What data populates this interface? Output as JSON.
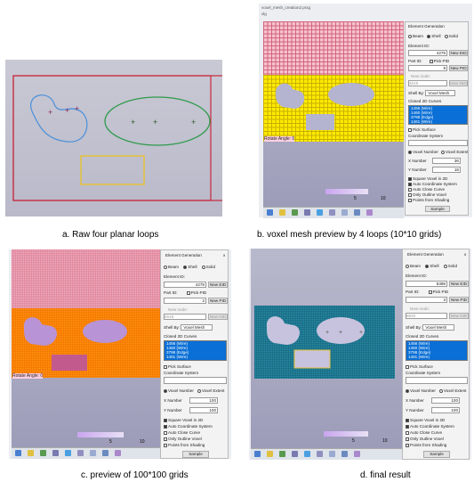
{
  "captions": {
    "a": "a. Raw four planar loops",
    "b": "b. voxel mesh preview by 4 loops (10*10 grids)",
    "c": "c. preview of 100*100 grids",
    "d": "d. final result"
  },
  "window_title": "voxel_mesh_creation2.prxg",
  "window_subtitle": "xlg",
  "rotate_label": "Rotate Angle: 0",
  "scale": {
    "min": "5",
    "max": "10"
  },
  "toolbar_labels": [
    "Voxel",
    "Shell",
    "Solid",
    "Loop",
    "Face",
    "Shells",
    "Shells",
    "Extr",
    "Surface"
  ],
  "dialog": {
    "title": "Element Generation",
    "close": "x",
    "types": [
      "Beam",
      "Shell",
      "Solid"
    ],
    "element_id_label": "Element ID:",
    "element_id_b": "4279",
    "element_id_d": "8398",
    "new_eid": "New EID",
    "part_id_label": "Part ID:",
    "pick_pid": "Pick PID",
    "part_id_value_b": "9",
    "part_id_value_c": "2",
    "part_id_value_d": "3",
    "new_pid": "New PID",
    "new_node_label": "New node:",
    "new_node_b": "4619",
    "new_node_d": "8820",
    "new_nid": "New NID",
    "shell_by_label": "Shell By:",
    "shell_by_value": "Voxel Mesh",
    "closed_curves_label": "Closed 2D Curves",
    "curves": [
      "1456 (Wire)",
      "1460 (Wire)",
      "3798 (Edge)",
      "1461 (Wire)"
    ],
    "pick_surface": "Pick Surface",
    "coord_system": "Coordinate System",
    "voxel_number": "Voxel Number",
    "voxel_extent": "Voxel Extent",
    "x_number_label": "X Number",
    "y_number_label": "Y Number",
    "x_b": "36",
    "y_b": "18",
    "x_c": "100",
    "y_c": "100",
    "options": [
      "Square Voxel in 2D",
      "Auto Coordinate System",
      "Auto Close Curve",
      "Only Outline Voxel",
      "Points from Shading"
    ],
    "sample": "Sample"
  }
}
